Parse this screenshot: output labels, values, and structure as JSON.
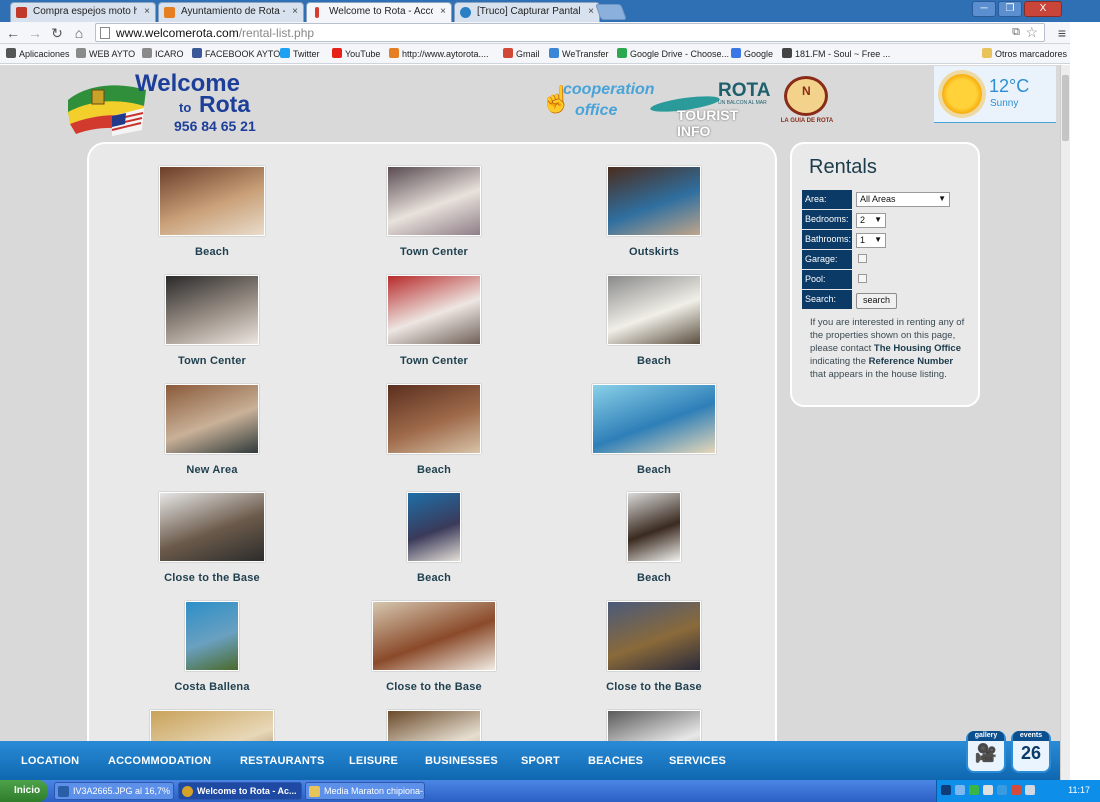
{
  "browser": {
    "tabs": [
      {
        "label": "Compra espejos moto honda",
        "color": "#c0392b"
      },
      {
        "label": "Ayuntamiento de Rota - Adm",
        "color": "#e67e22"
      },
      {
        "label": "Welcome to Rota - Accommo",
        "color": "#d63c2f"
      },
      {
        "label": "[Truco] Capturar Pantallas d",
        "color": "#2a7fc4"
      }
    ],
    "window_controls": {
      "minimize": "─",
      "restore": "❐",
      "close": "X"
    },
    "url": "www.welcomerota.com",
    "url_path": "/rental-list.php",
    "bookmarks": [
      {
        "label": "Aplicaciones",
        "color": "#555555"
      },
      {
        "label": "WEB AYTO",
        "color": "#8a8a8a"
      },
      {
        "label": "ICARO",
        "color": "#8a8a8a"
      },
      {
        "label": "FACEBOOK AYTO",
        "color": "#3b5998"
      },
      {
        "label": "Twitter",
        "color": "#1da1f2"
      },
      {
        "label": "YouTube",
        "color": "#e62117"
      },
      {
        "label": "http://www.aytorota....",
        "color": "#e67e22"
      },
      {
        "label": "Gmail",
        "color": "#d14836"
      },
      {
        "label": "WeTransfer",
        "color": "#3a87d6"
      },
      {
        "label": "Google Drive - Choose...",
        "color": "#2ca84e"
      },
      {
        "label": "Google",
        "color": "#3b78e7"
      },
      {
        "label": "181.FM - Soul ~ Free ...",
        "color": "#444444"
      }
    ],
    "other_bookmarks": "Otros marcadores"
  },
  "site": {
    "logo": {
      "welcome": "Welcome",
      "to": "to",
      "rota": "Rota",
      "phone": "956 84 65 21"
    },
    "cooperation": {
      "line1": "cooperation",
      "line2": "office"
    },
    "tourist": {
      "rota": "ROTA",
      "subtitle": "UN BALCON AL MAR",
      "info": "TOURIST INFO"
    },
    "guia": {
      "label": "LA GUIA DE ROTA"
    },
    "weather": {
      "temp": "12°C",
      "condition": "Sunny"
    }
  },
  "listings": [
    {
      "caption": "Beach"
    },
    {
      "caption": "Town Center"
    },
    {
      "caption": "Outskirts"
    },
    {
      "caption": "Town Center"
    },
    {
      "caption": "Town Center"
    },
    {
      "caption": "Beach"
    },
    {
      "caption": "New Area"
    },
    {
      "caption": "Beach"
    },
    {
      "caption": "Beach"
    },
    {
      "caption": "Close to the Base"
    },
    {
      "caption": "Beach"
    },
    {
      "caption": "Beach"
    },
    {
      "caption": "Costa Ballena"
    },
    {
      "caption": "Close to the Base"
    },
    {
      "caption": "Close to the Base"
    },
    {
      "caption": ""
    },
    {
      "caption": ""
    },
    {
      "caption": ""
    }
  ],
  "rentals": {
    "title": "Rentals",
    "area_label": "Area:",
    "area_value": "All Areas",
    "bedrooms_label": "Bedrooms:",
    "bedrooms_value": "2",
    "bathrooms_label": "Bathrooms:",
    "bathrooms_value": "1",
    "garage_label": "Garage:",
    "pool_label": "Pool:",
    "search_label": "Search:",
    "search_button": "search",
    "note_1": "If you are interested in renting any of the properties shown on this page, please contact ",
    "note_office": "The Housing Office",
    "note_2": " indicating the ",
    "note_ref": "Reference Number",
    "note_3": " that appears in the house listing."
  },
  "nav": {
    "items": [
      "LOCATION",
      "ACCOMMODATION",
      "RESTAURANTS",
      "LEISURE",
      "BUSINESSES",
      "SPORT",
      "BEACHES",
      "SERVICES"
    ],
    "gallery": "gallery",
    "events": "events",
    "events_count": "26"
  },
  "taskbar": {
    "start": "Inicio",
    "tasks": [
      {
        "label": "IV3A2665.JPG al 16,7% ...",
        "color": "#2a5fa8"
      },
      {
        "label": "Welcome to Rota - Ac...",
        "color": "#d6a32a"
      },
      {
        "label": "Media Maraton chipiona-...",
        "color": "#e8c35a"
      }
    ],
    "clock": "11:17"
  }
}
